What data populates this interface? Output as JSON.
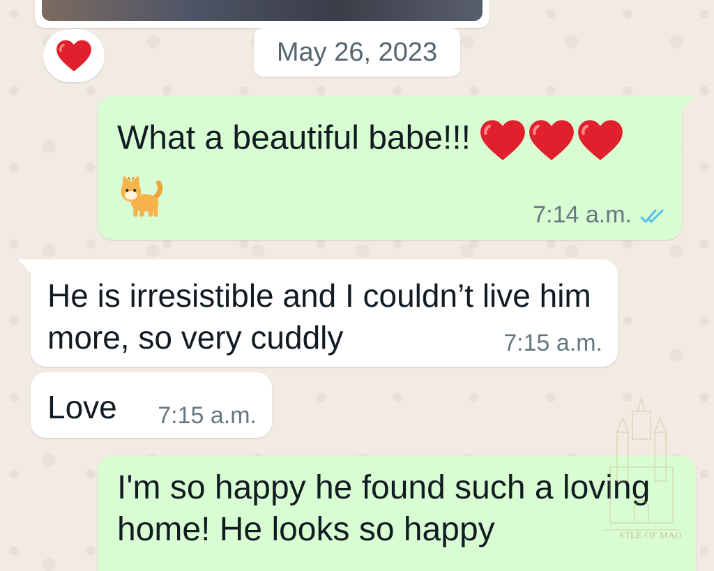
{
  "date_separator": "May 26, 2023",
  "reaction": {
    "emoji": "heart-emoji"
  },
  "messages": [
    {
      "direction": "outgoing",
      "text": "What a beautiful babe!!!",
      "emoji": [
        "heart-emoji",
        "heart-emoji",
        "heart-emoji",
        "cat-emoji"
      ],
      "time": "7:14 a.m.",
      "status": "read"
    },
    {
      "direction": "incoming",
      "text": "He is irresistible and I couldn’t live him more, so very cuddly",
      "time": "7:15 a.m."
    },
    {
      "direction": "incoming",
      "text": "Love",
      "time": "7:15 a.m."
    },
    {
      "direction": "outgoing",
      "text": "I'm so happy he found such a loving home! He looks so happy"
    }
  ],
  "watermark": {
    "label": "STLE OF MAO"
  },
  "colors": {
    "outgoing_bubble": "#d9fdd3",
    "incoming_bubble": "#ffffff",
    "read_ticks": "#53bdeb",
    "timestamp": "#667781",
    "wallpaper": "#efeae2"
  }
}
